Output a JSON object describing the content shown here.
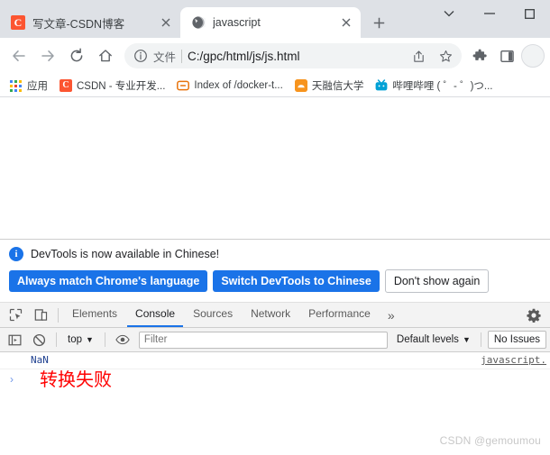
{
  "window": {
    "controls": {
      "tab_search": "chevron-down",
      "minimize": "minimize",
      "maximize": "maximize"
    }
  },
  "tabstrip": {
    "tabs": [
      {
        "title": "写文章-CSDN博客",
        "favicon": "csdn-icon",
        "active": false,
        "close_label": "×"
      },
      {
        "title": "javascript",
        "favicon": "globe-icon",
        "active": true,
        "close_label": "×"
      }
    ],
    "new_tab_label": "+"
  },
  "toolbar": {
    "back_label": "←",
    "forward_label": "→",
    "reload_label": "⟳",
    "home_label": "⌂",
    "omnibox": {
      "scheme_label": "文件",
      "url": "C:/gpc/html/js/js.html",
      "share_icon": "share-icon",
      "bookmark_icon": "star-icon"
    },
    "extensions_icon": "puzzle-icon",
    "sidepanel_icon": "side-panel-icon"
  },
  "bookmarks": [
    {
      "label": "应用",
      "icon": "apps-grid-icon"
    },
    {
      "label": "CSDN - 专业开发...",
      "icon": "csdn-icon"
    },
    {
      "label": "Index of /docker-t...",
      "icon": "docker-index-icon"
    },
    {
      "label": "天融信大学",
      "icon": "tianrongxin-icon"
    },
    {
      "label": "哔哩哔哩 ( ゜- ゜)つ...",
      "icon": "bilibili-icon"
    }
  ],
  "devtools": {
    "banner": {
      "info_icon": "info-icon",
      "message": "DevTools is now available in Chinese!",
      "buttons": [
        {
          "label": "Always match Chrome's language",
          "style": "primary"
        },
        {
          "label": "Switch DevTools to Chinese",
          "style": "primary"
        },
        {
          "label": "Don't show again",
          "style": "secondary"
        }
      ]
    },
    "tabs": {
      "inspect_icon": "inspect-element-icon",
      "device_icon": "device-toolbar-icon",
      "items": [
        {
          "label": "Elements",
          "selected": false
        },
        {
          "label": "Console",
          "selected": true
        },
        {
          "label": "Sources",
          "selected": false
        },
        {
          "label": "Network",
          "selected": false
        },
        {
          "label": "Performance",
          "selected": false
        }
      ],
      "overflow_label": "»",
      "settings_icon": "gear-icon"
    },
    "console_toolbar": {
      "sidebar_icon": "console-sidebar-icon",
      "clear_icon": "clear-console-icon",
      "context_label": "top",
      "context_caret": "▼",
      "eye_icon": "live-expression-icon",
      "filter_placeholder": "Filter",
      "filter_value": "",
      "levels_label": "Default levels",
      "levels_caret": "▼",
      "issues_label": "No Issues"
    },
    "console_output": {
      "messages": [
        {
          "text": "NaN",
          "source": "javascript."
        }
      ],
      "prompt_caret": "›"
    }
  },
  "page": {
    "red_text": "转换失败"
  },
  "watermark": "CSDN @gemoumou",
  "colors": {
    "chrome_tabstrip": "#dee1e6",
    "accent_blue": "#1a73e8",
    "error_red": "#ff0000",
    "csdn_orange": "#fc5531",
    "console_value_blue": "#1d3f8f"
  }
}
